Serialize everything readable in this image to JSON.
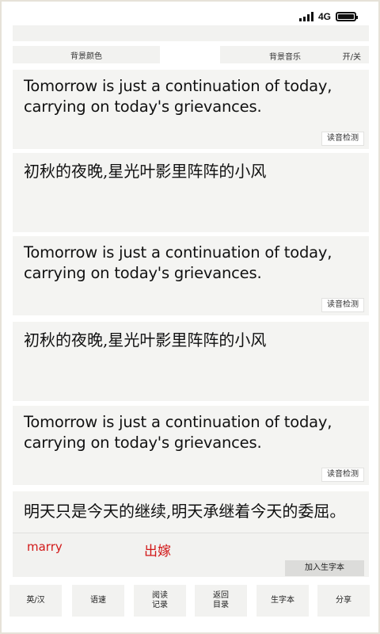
{
  "status_bar": {
    "network": "4G",
    "signal_icon": "signal-bars-icon",
    "battery_icon": "battery-icon"
  },
  "settings": {
    "background_color_label": "背景颜色",
    "background_music_label": "背景音乐",
    "music_toggle_label": "开/关"
  },
  "cards": [
    {
      "type": "en",
      "text": "Tomorrow is just a continuation of today, carrying on today's grievances.",
      "detect_label": "读音检测"
    },
    {
      "type": "zh",
      "text": "初秋的夜晚,星光叶影里阵阵的小风"
    },
    {
      "type": "en",
      "text": "Tomorrow is just a continuation of today, carrying on today's grievances.",
      "detect_label": "读音检测"
    },
    {
      "type": "zh",
      "text": "初秋的夜晚,星光叶影里阵阵的小风"
    },
    {
      "type": "en",
      "text": "Tomorrow is just a continuation of today, carrying on today's grievances.",
      "detect_label": "读音检测"
    },
    {
      "type": "zh",
      "text": "明天只是今天的继续,明天承继着今天的委屈。"
    }
  ],
  "popup": {
    "word": "marry",
    "meaning": "出嫁",
    "add_label": "加入生字本",
    "accent_color": "#d21818"
  },
  "bottom_bar": {
    "en_zh": "英/汉",
    "speed": "语速",
    "reading_record": "阅读\n记录",
    "back_to_contents": "返回\n目录",
    "vocab_book": "生字本",
    "share": "分享"
  }
}
